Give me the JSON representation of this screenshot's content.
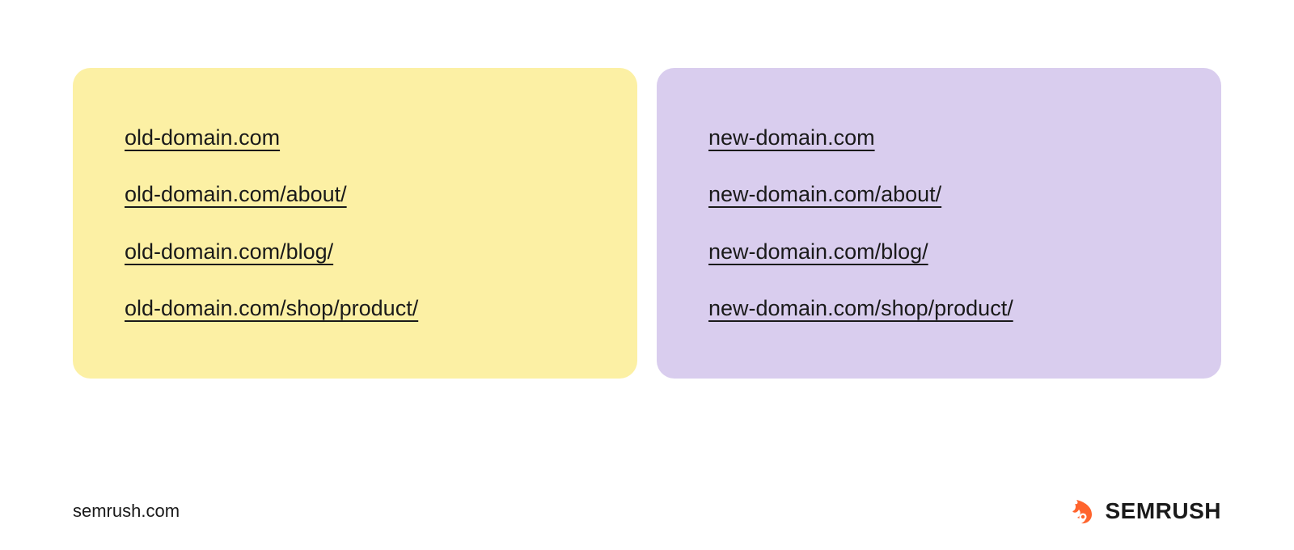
{
  "panels": {
    "left": {
      "bg": "#fcf0a4",
      "urls": [
        "old-domain.com",
        "old-domain.com/about/",
        "old-domain.com/blog/",
        "old-domain.com/shop/product/"
      ]
    },
    "right": {
      "bg": "#d9cdee",
      "urls": [
        "new-domain.com",
        "new-domain.com/about/",
        "new-domain.com/blog/",
        "new-domain.com/shop/product/"
      ]
    }
  },
  "footer": {
    "site": "semrush.com",
    "brand": "SEMRUSH"
  },
  "colors": {
    "accent": "#ff642d",
    "text": "#1a1a1a"
  }
}
